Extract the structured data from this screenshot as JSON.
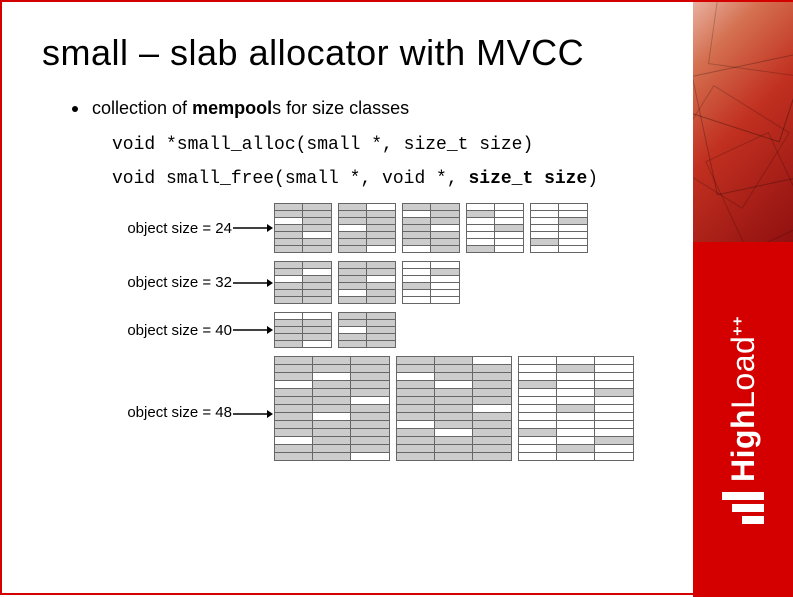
{
  "title": "small – slab allocator with MVCC",
  "bullet": {
    "text_before": "collection of ",
    "bold": "mempool",
    "text_after": "s for size classes"
  },
  "code": {
    "line1": "void *small_alloc(small *, size_t size)",
    "line2_pre": "void small_free(small *, void *, ",
    "line2_bold": "size_t size",
    "line2_post": ")"
  },
  "rows": [
    {
      "label": "object size = 24",
      "key": "r24"
    },
    {
      "label": "object size = 32",
      "key": "r32"
    },
    {
      "label": "object size = 40",
      "key": "r40"
    },
    {
      "label": "object size = 48",
      "key": "r48"
    }
  ],
  "brand": {
    "name_high": "High",
    "name_load": "Load",
    "plus": "++"
  }
}
